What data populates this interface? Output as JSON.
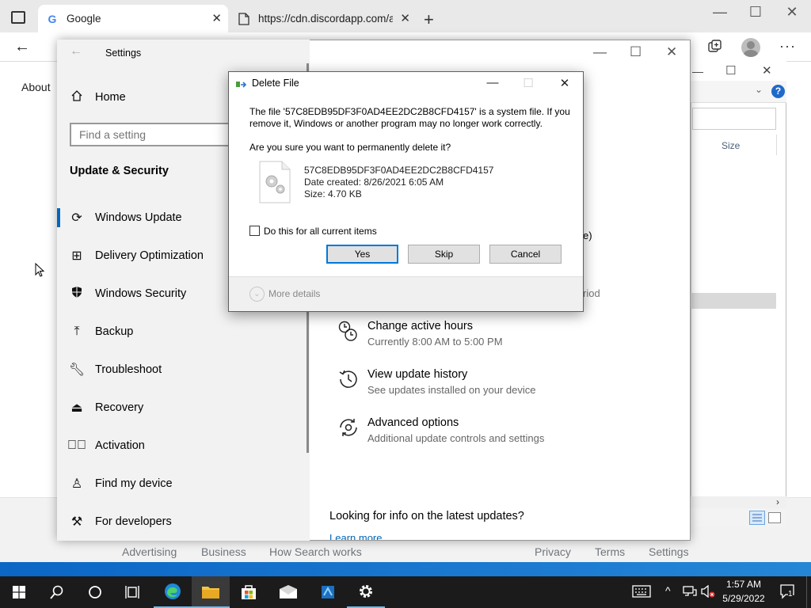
{
  "browser": {
    "tabs": [
      {
        "title": "Google",
        "favicon": "G"
      },
      {
        "title": "https://cdn.discordapp.com/atta",
        "favicon": "page-icon"
      }
    ],
    "about_link": "About",
    "footer_links": [
      "Advertising",
      "Business",
      "How Search works",
      "Privacy",
      "Terms",
      "Settings"
    ]
  },
  "explorer": {
    "size_column": "Size"
  },
  "settings": {
    "window_title": "Settings",
    "home": "Home",
    "search_placeholder": "Find a setting",
    "section_title": "Update & Security",
    "nav": [
      {
        "label": "Windows Update",
        "icon": "refresh-icon"
      },
      {
        "label": "Delivery Optimization",
        "icon": "delivery-icon"
      },
      {
        "label": "Windows Security",
        "icon": "shield-icon"
      },
      {
        "label": "Backup",
        "icon": "backup-icon"
      },
      {
        "label": "Troubleshoot",
        "icon": "wrench-icon"
      },
      {
        "label": "Recovery",
        "icon": "recovery-icon"
      },
      {
        "label": "Activation",
        "icon": "check-circle-icon"
      },
      {
        "label": "Find my device",
        "icon": "person-icon"
      },
      {
        "label": "For developers",
        "icon": "tools-icon"
      }
    ],
    "clipped": {
      "text1": "e)",
      "text2": "riod"
    },
    "options": [
      {
        "title": "Change active hours",
        "subtitle": "Currently 8:00 AM to 5:00 PM",
        "icon": "clock-icon"
      },
      {
        "title": "View update history",
        "subtitle": "See updates installed on your device",
        "icon": "history-icon"
      },
      {
        "title": "Advanced options",
        "subtitle": "Additional update controls and settings",
        "icon": "gear-refresh-icon"
      }
    ],
    "info_heading": "Looking for info on the latest updates?",
    "learn_more": "Learn more"
  },
  "dialog": {
    "title": "Delete File",
    "message_line1": "The file '57C8EDB95DF3F0AD4EE2DC2B8CFD4157' is a system file. If you",
    "message_line2": "remove it, Windows or another program may no longer work correctly.",
    "question": "Are you sure you want to permanently delete it?",
    "file_name": "57C8EDB95DF3F0AD4EE2DC2B8CFD4157",
    "date_created": "Date created: 8/26/2021 6:05 AM",
    "size": "Size: 4.70 KB",
    "checkbox_label": "Do this for all current items",
    "checkbox_checked": false,
    "buttons": {
      "yes": "Yes",
      "skip": "Skip",
      "cancel": "Cancel"
    },
    "more_details": "More details"
  },
  "taskbar": {
    "time": "1:57 AM",
    "date": "5/29/2022",
    "notification_count": "1",
    "accent": "#76b9ed"
  }
}
